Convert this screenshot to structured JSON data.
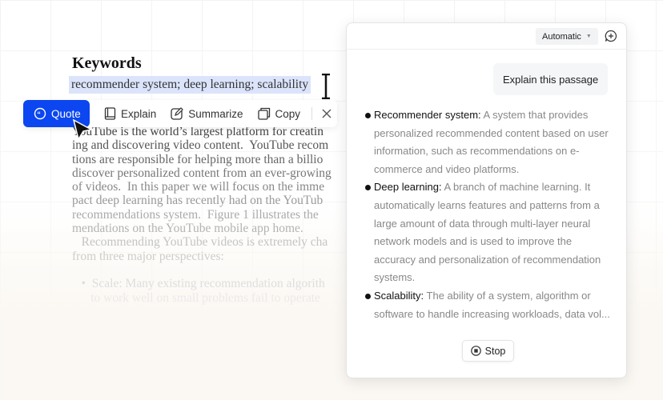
{
  "document": {
    "heading": "Keywords",
    "selected_text": "recommender system; deep learning; scalability",
    "lines": [
      {
        "text": "YouTube is the world’s largest platform for creatin",
        "color": "#444"
      },
      {
        "text": "ing and discovering video content.  YouTube recom",
        "color": "#555"
      },
      {
        "text": "tions are responsible for helping more than a billio",
        "color": "#666"
      },
      {
        "text": "discover personalized content from an ever-growing",
        "color": "#777"
      },
      {
        "text": "of videos.  In this paper we will focus on the imme",
        "color": "#888"
      },
      {
        "text": "pact deep learning has recently had on the YouTub",
        "color": "#999"
      },
      {
        "text": "recommendations system.  Figure 1 illustrates the",
        "color": "#aaa"
      },
      {
        "text": "mendations on the YouTube mobile app home.",
        "color": "#b3b3b3"
      },
      {
        "text": "   Recommending YouTube videos is extremely cha",
        "color": "#c4c4c4"
      },
      {
        "text": "from three major perspectives:",
        "color": "#cdcdcd"
      },
      {
        "text": "",
        "color": "#ddd"
      },
      {
        "text": "   •  Scale: Many existing recommendation algorith",
        "color": "#dedede"
      },
      {
        "text": "      to work well on small problems fail to operate",
        "color": "#eaeaea"
      }
    ]
  },
  "toolbar": {
    "quote": "Quote",
    "explain": "Explain",
    "summarize": "Summarize",
    "copy": "Copy",
    "accent": "#0b46f0"
  },
  "panel": {
    "mode": "Automatic",
    "user_message": "Explain this passage",
    "items": [
      {
        "term": "Recommender system:",
        "text": " A system that provides personalized recommended content based on user information, such as recommendations on e-commerce and video platforms."
      },
      {
        "term": "Deep learning:",
        "text": " A branch of machine learning. It automatically learns features and patterns from a large amount of data through multi-layer neural network models and is used to improve the accuracy and personalization of recommendation systems."
      },
      {
        "term": "Scalability:",
        "text": " The ability of a system, algorithm or software to handle increasing workloads, data vol..."
      }
    ],
    "stop": "Stop"
  }
}
